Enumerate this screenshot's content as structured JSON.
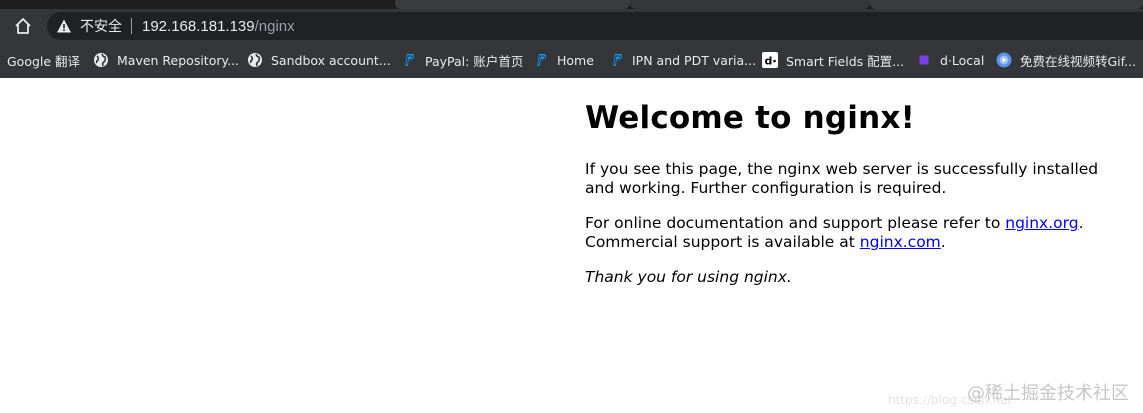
{
  "browser": {
    "address_bar": {
      "security_label": "不安全",
      "url_host": "192.168.181.139",
      "url_path": "/nginx"
    },
    "bookmarks": [
      {
        "label": "Google 翻译",
        "icon": "none"
      },
      {
        "label": "Maven Repository...",
        "icon": "globe-icon"
      },
      {
        "label": "Sandbox account...",
        "icon": "globe-icon"
      },
      {
        "label": "PayPal: 账户首页",
        "icon": "paypal-icon"
      },
      {
        "label": "Home",
        "icon": "paypal-icon"
      },
      {
        "label": "IPN and PDT varia...",
        "icon": "paypal-icon"
      },
      {
        "label": "Smart Fields 配置...",
        "icon": "dlocal-icon"
      },
      {
        "label": "d·Local",
        "icon": "purple-square-icon"
      },
      {
        "label": "免费在线视频转Gif...",
        "icon": "gif-converter-icon"
      }
    ],
    "colors": {
      "chrome_dark": "#35363a",
      "omnibox_bg": "#202124",
      "link": "#0000ee",
      "paypal_blue": "#179bd7",
      "dlocal_purple": "#7b3fe4"
    }
  },
  "page": {
    "heading": "Welcome to nginx!",
    "para1": "If you see this page, the nginx web server is successfully installed and working. Further configuration is required.",
    "para2_prefix": "For online documentation and support please refer to ",
    "link1": "nginx.org",
    "para2_mid": ".",
    "para2_line2_prefix": "Commercial support is available at ",
    "link2": "nginx.com",
    "para2_end": ".",
    "thanks": "Thank you for using nginx."
  },
  "watermark": {
    "url_text": "https://blog.csdn.net",
    "brand": "@稀土掘金技术社区"
  }
}
